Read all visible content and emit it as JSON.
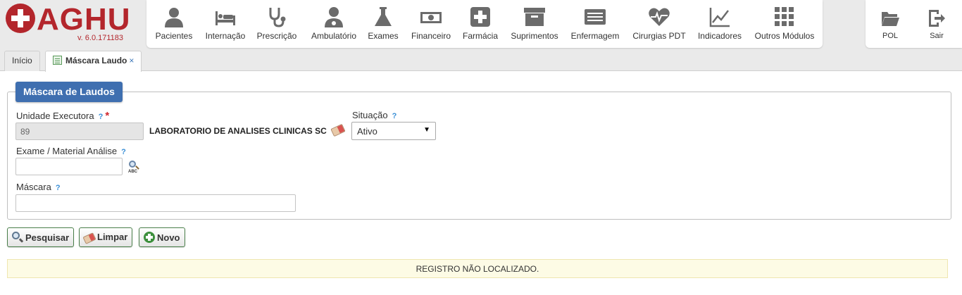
{
  "app": {
    "logo_text": "AGHU",
    "version": "v. 6.0.171183"
  },
  "modules": [
    {
      "label": "Pacientes",
      "icon": "person-icon"
    },
    {
      "label": "Internação",
      "icon": "bed-icon"
    },
    {
      "label": "Prescrição",
      "icon": "stethoscope-icon"
    },
    {
      "label": "Ambulatório",
      "icon": "doctor-icon"
    },
    {
      "label": "Exames",
      "icon": "flask-icon"
    },
    {
      "label": "Financeiro",
      "icon": "money-icon"
    },
    {
      "label": "Farmácia",
      "icon": "plus-box-icon"
    },
    {
      "label": "Suprimentos",
      "icon": "archive-box-icon"
    },
    {
      "label": "Enfermagem",
      "icon": "list-card-icon"
    },
    {
      "label": "Cirurgias PDT",
      "icon": "heartbeat-icon"
    },
    {
      "label": "Indicadores",
      "icon": "line-chart-icon"
    },
    {
      "label": "Outros Módulos",
      "icon": "grid-icon"
    }
  ],
  "right_modules": [
    {
      "label": "POL",
      "icon": "folder-open-icon"
    },
    {
      "label": "Sair",
      "icon": "exit-door-icon"
    }
  ],
  "tabs": [
    {
      "label": "Início",
      "active": false
    },
    {
      "label": "Máscara Laudo",
      "active": true,
      "close": "×"
    }
  ],
  "form": {
    "legend": "Máscara de Laudos",
    "help_glyph": "?",
    "required_glyph": "*",
    "unidade_label": "Unidade Executora",
    "unidade_value": "89",
    "unidade_desc": "LABORATORIO DE ANALISES CLINICAS SC",
    "situacao_label": "Situação",
    "situacao_value": "Ativo",
    "situacao_arrow": "▼",
    "exame_label": "Exame / Material Análise",
    "exame_value": "",
    "lookup_text": "ABC",
    "mascara_label": "Máscara",
    "mascara_value": ""
  },
  "buttons": {
    "pesquisar": "Pesquisar",
    "limpar": "Limpar",
    "novo": "Novo"
  },
  "message": "REGISTRO NÃO LOCALIZADO.",
  "colors": {
    "brand": "#b3262c",
    "legend_bg": "#3f6fb0",
    "help": "#3a8fd6",
    "message_bg": "#fdfbe5"
  }
}
